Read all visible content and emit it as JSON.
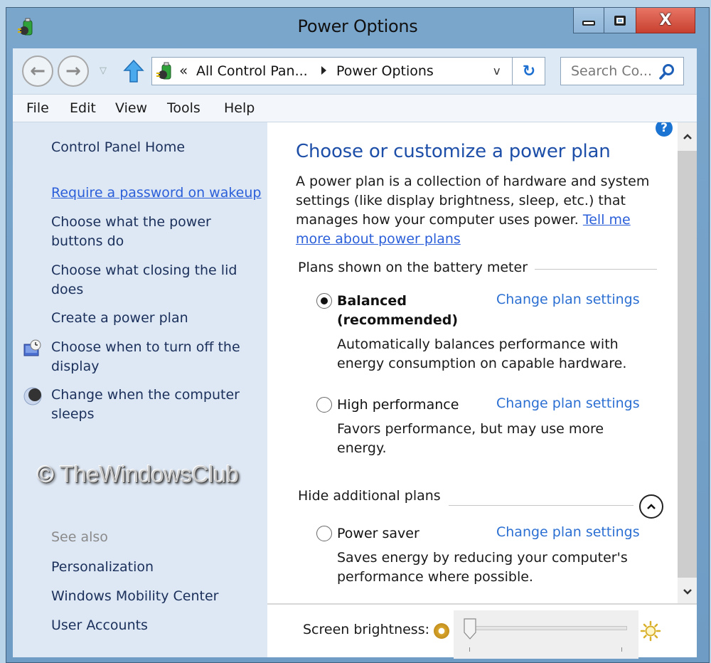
{
  "window": {
    "title": "Power Options",
    "close_glyph": "X"
  },
  "navbar": {
    "back_glyph": "←",
    "forward_glyph": "→",
    "recent_glyph": "▽",
    "address": {
      "overflow_glyph": "«",
      "crumbs": [
        "All Control Pan...",
        "Power Options"
      ],
      "dropdown_glyph": "v",
      "refresh_glyph": "↻"
    },
    "search": {
      "placeholder": "Search Co..."
    }
  },
  "menu": [
    "File",
    "Edit",
    "View",
    "Tools",
    "Help"
  ],
  "sidebar": {
    "home": "Control Panel Home",
    "links": [
      {
        "label": "Require a password on wakeup",
        "underlined": true
      },
      {
        "label": "Choose what the power buttons do"
      },
      {
        "label": "Choose what closing the lid does"
      },
      {
        "label": "Create a power plan"
      },
      {
        "label": "Choose when to turn off the display",
        "icon": "display-clock-icon"
      },
      {
        "label": "Change when the computer sleeps",
        "icon": "moon-sleep-icon"
      }
    ],
    "watermark": "© TheWindowsClub",
    "see_also": {
      "heading": "See also",
      "links": [
        "Personalization",
        "Windows Mobility Center",
        "User Accounts"
      ]
    }
  },
  "main": {
    "heading": "Choose or customize a power plan",
    "intro": "A power plan is a collection of hardware and system settings (like display brightness, sleep, etc.) that manages how your computer uses power.",
    "intro_link": "Tell me more about power plans",
    "group1_label": "Plans shown on the battery meter",
    "group2_label": "Hide additional plans",
    "change_label": "Change plan settings",
    "plans": [
      {
        "name_line1": "Balanced",
        "name_line2": "(recommended)",
        "selected": true,
        "description": "Automatically balances performance with energy consumption on capable hardware."
      },
      {
        "name_line1": "High performance",
        "selected": false,
        "description": "Favors performance, but may use more energy."
      },
      {
        "name_line1": "Power saver",
        "selected": false,
        "description": "Saves energy by reducing your computer's performance where possible."
      }
    ],
    "help_glyph": "?"
  },
  "footer": {
    "brightness_label": "Screen brightness:",
    "brightness_value_percent": 0
  },
  "colors": {
    "link": "#2b5fd9",
    "heading": "#1e4fa8",
    "close_button": "#d9503f",
    "titlebar": "#7aa6cc"
  }
}
